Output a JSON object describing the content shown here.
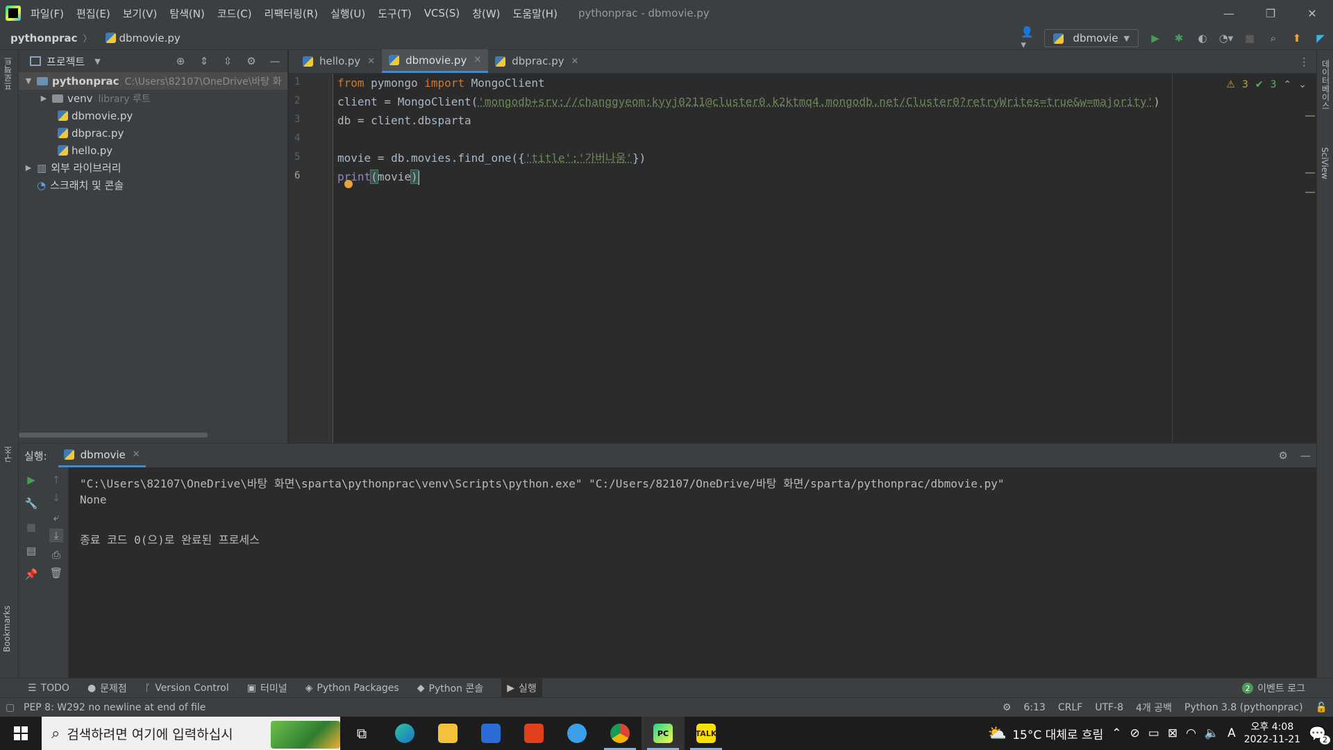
{
  "menu": {
    "items": [
      "파일(F)",
      "편집(E)",
      "보기(V)",
      "탐색(N)",
      "코드(C)",
      "리팩터링(R)",
      "실행(U)",
      "도구(T)",
      "VCS(S)",
      "창(W)",
      "도움말(H)"
    ],
    "window_title": "pythonprac - dbmovie.py"
  },
  "navbar": {
    "project": "pythonprac",
    "file": "dbmovie.py",
    "run_config": "dbmovie"
  },
  "left_strip": {
    "project_tab": "프로젝트",
    "structure_tab": "구조",
    "bookmarks_tab": "Bookmarks"
  },
  "right_strip": {
    "database_tab": "데이터베이스",
    "sciview_tab": "SciView"
  },
  "project_panel": {
    "title": "프로젝트",
    "root": {
      "name": "pythonprac",
      "path": "C:\\Users\\82107\\OneDrive\\바탕 화"
    },
    "venv": {
      "name": "venv",
      "hint": "library 루트"
    },
    "files": [
      "dbmovie.py",
      "dbprac.py",
      "hello.py"
    ],
    "external_libs": "외부 라이브러리",
    "scratches": "스크래치 및 콘솔"
  },
  "editor": {
    "tabs": [
      {
        "label": "hello.py",
        "active": false
      },
      {
        "label": "dbmovie.py",
        "active": true
      },
      {
        "label": "dbprac.py",
        "active": false
      }
    ],
    "line_numbers": [
      "1",
      "2",
      "3",
      "4",
      "5",
      "6"
    ],
    "inspections": {
      "warnings": "3",
      "ok": "3"
    },
    "code": {
      "l1_kw1": "from",
      "l1_mod": " pymongo ",
      "l1_kw2": "import",
      "l1_cls": " MongoClient",
      "l2_a": "client = MongoClient(",
      "l2_str": "'mongodb+srv://changgyeom:kyyj0211@cluster0.k2ktmq4.mongodb.net/Cluster0?retryWrites=true&w=majority'",
      "l2_b": ")",
      "l3": "db = client.dbsparta",
      "l5_a": "movie = db.movies.find_one({",
      "l5_s1": "'title'",
      "l5_c": ":",
      "l5_s2": "'가버나움'",
      "l5_b": "})",
      "l6_fn": "print",
      "l6_p1": "(",
      "l6_arg": "movie",
      "l6_p2": ")"
    }
  },
  "run_panel": {
    "label": "실행:",
    "tab": "dbmovie",
    "output": [
      "\"C:\\Users\\82107\\OneDrive\\바탕 화면\\sparta\\pythonprac\\venv\\Scripts\\python.exe\" \"C:/Users/82107/OneDrive/바탕 화면/sparta/pythonprac/dbmovie.py\"",
      "None",
      "",
      "종료 코드 0(으)로 완료된 프로세스"
    ]
  },
  "toolwindows": {
    "items": [
      "TODO",
      "문제점",
      "Version Control",
      "터미널",
      "Python Packages",
      "Python 콘솔",
      "실행"
    ],
    "event_log": "이벤트 로그",
    "event_count": "2"
  },
  "status": {
    "message": "PEP 8: W292 no newline at end of file",
    "position": "6:13",
    "line_sep": "CRLF",
    "encoding": "UTF-8",
    "indent": "4개 공백",
    "interpreter": "Python 3.8 (pythonprac)"
  },
  "taskbar": {
    "search_placeholder": "검색하려면 여기에 입력하십시",
    "weather": "15°C  대체로 흐림",
    "time": "오후 4:08",
    "date": "2022-11-21",
    "notif_count": "2",
    "ime": "A"
  }
}
